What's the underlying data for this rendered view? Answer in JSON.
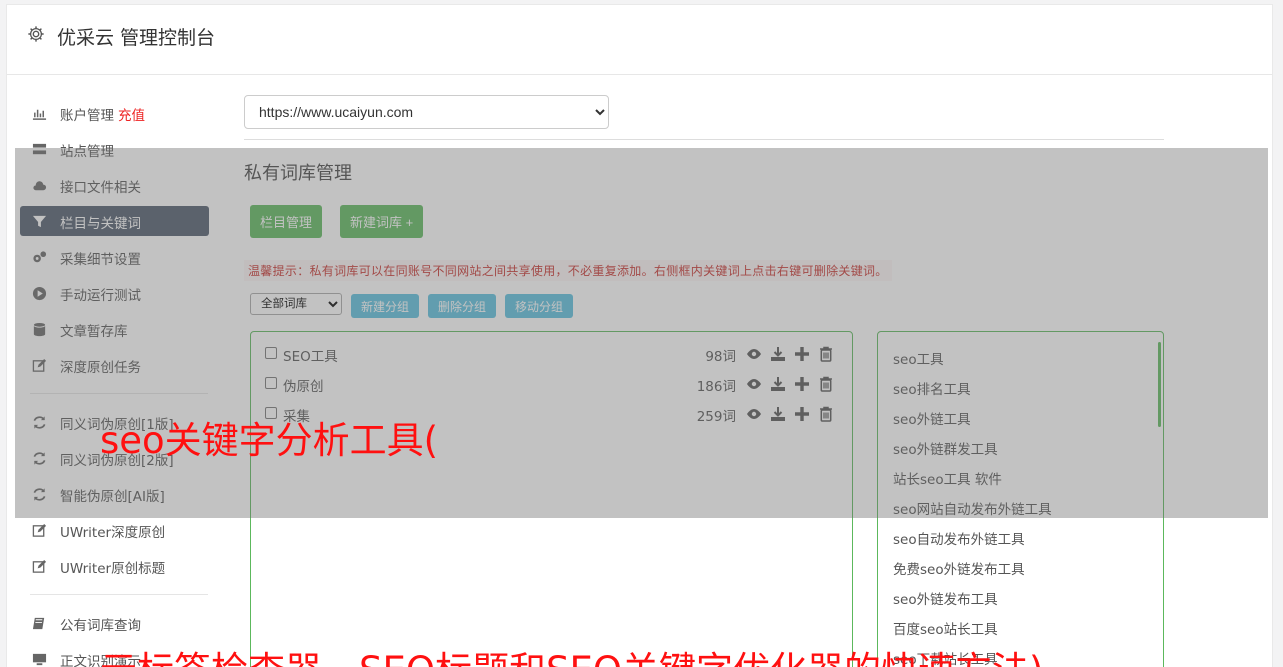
{
  "header": {
    "title": "优采云 管理控制台",
    "icon": "gear-icon"
  },
  "sidebar": {
    "items": [
      {
        "label": "账户管理",
        "extra": "充值",
        "icon": "bar-chart-icon"
      },
      {
        "label": "站点管理",
        "icon": "server-icon"
      },
      {
        "label": "接口文件相关",
        "icon": "cloud-upload-icon"
      },
      {
        "label": "栏目与关键词",
        "icon": "filter-icon",
        "active": true
      },
      {
        "label": "采集细节设置",
        "icon": "gears-icon"
      },
      {
        "label": "手动运行测试",
        "icon": "play-circle-icon"
      },
      {
        "label": "文章暂存库",
        "icon": "database-icon"
      },
      {
        "label": "深度原创任务",
        "icon": "edit-icon"
      },
      {
        "label": "同义词伪原创[1版]",
        "icon": "refresh-icon"
      },
      {
        "label": "同义词伪原创[2版]",
        "icon": "refresh-icon"
      },
      {
        "label": "智能伪原创[AI版]",
        "icon": "refresh-icon"
      },
      {
        "label": "UWriter深度原创",
        "icon": "edit-icon"
      },
      {
        "label": "UWriter原创标题",
        "icon": "edit-icon"
      },
      {
        "label": "公有词库查询",
        "icon": "book-icon"
      },
      {
        "label": "正文识别演示",
        "icon": "monitor-icon"
      }
    ]
  },
  "main": {
    "site_select": "https://www.ucaiyun.com",
    "section_title": "私有词库管理",
    "buttons": {
      "column_manage": "栏目管理",
      "new_library": "新建词库 +"
    },
    "tip": "温馨提示：私有词库可以在同账号不同网站之间共享使用，不必重复添加。右侧框内关键词上点击右键可删除关键词。",
    "library_filter": "全部词库",
    "group_buttons": {
      "new_group": "新建分组",
      "delete_group": "删除分组",
      "move_group": "移动分组"
    },
    "libraries": [
      {
        "name": "SEO工具",
        "count": "98词"
      },
      {
        "name": "伪原创",
        "count": "186词"
      },
      {
        "name": "采集",
        "count": "259词"
      }
    ],
    "keywords": [
      "seo工具",
      "seo排名工具",
      "seo外链工具",
      "seo外链群发工具",
      "站长seo工具 软件",
      "seo网站自动发布外链工具",
      "seo自动发布外链工具",
      "免费seo外链发布工具",
      "seo外链发布工具",
      "百度seo站长工具",
      "seo下载站长工具"
    ]
  },
  "overlay_text": {
    "top": "seo关键字分析工具(",
    "bottom": "元标签检查器，SEO标题和SEO关键字优化器的快速方法)"
  },
  "colors": {
    "active_bg": "#4e5a6b",
    "green": "#5cb85c",
    "blue": "#5bc0de",
    "red_text": "#ff1010"
  }
}
